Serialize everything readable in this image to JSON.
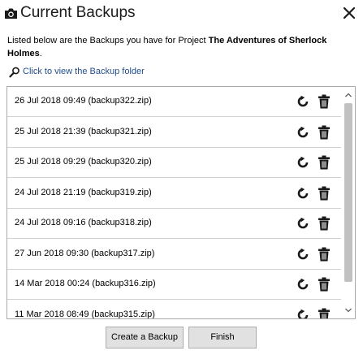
{
  "window": {
    "title": "Current Backups",
    "title_icon": "camera-icon",
    "close_icon": "close-icon"
  },
  "description": {
    "prefix": "Listed below are the Backups you have for Project ",
    "project_name": "The Adventures of Sherlock Holmes",
    "suffix": "."
  },
  "folder_link": {
    "label": "Click to view the Backup folder",
    "icon": "search-icon",
    "color": "#1f4e8c"
  },
  "backups": [
    {
      "label": "26 Jul 2018 09:49 (backup322.zip)"
    },
    {
      "label": "25 Jul 2018 21:39 (backup321.zip)"
    },
    {
      "label": "25 Jul 2018 09:29 (backup320.zip)"
    },
    {
      "label": "24 Jul 2018 21:19 (backup319.zip)"
    },
    {
      "label": "24 Jul 2018 09:16 (backup318.zip)"
    },
    {
      "label": "27 Jun 2018 09:30 (backup317.zip)"
    },
    {
      "label": "14 Mar 2018 00:24 (backup316.zip)"
    },
    {
      "label": "11 Mar 2018 08:49 (backup315.zip)"
    }
  ],
  "row_icons": {
    "restore": "restore-icon",
    "delete": "trash-icon"
  },
  "buttons": {
    "create": "Create a Backup",
    "finish": "Finish"
  }
}
